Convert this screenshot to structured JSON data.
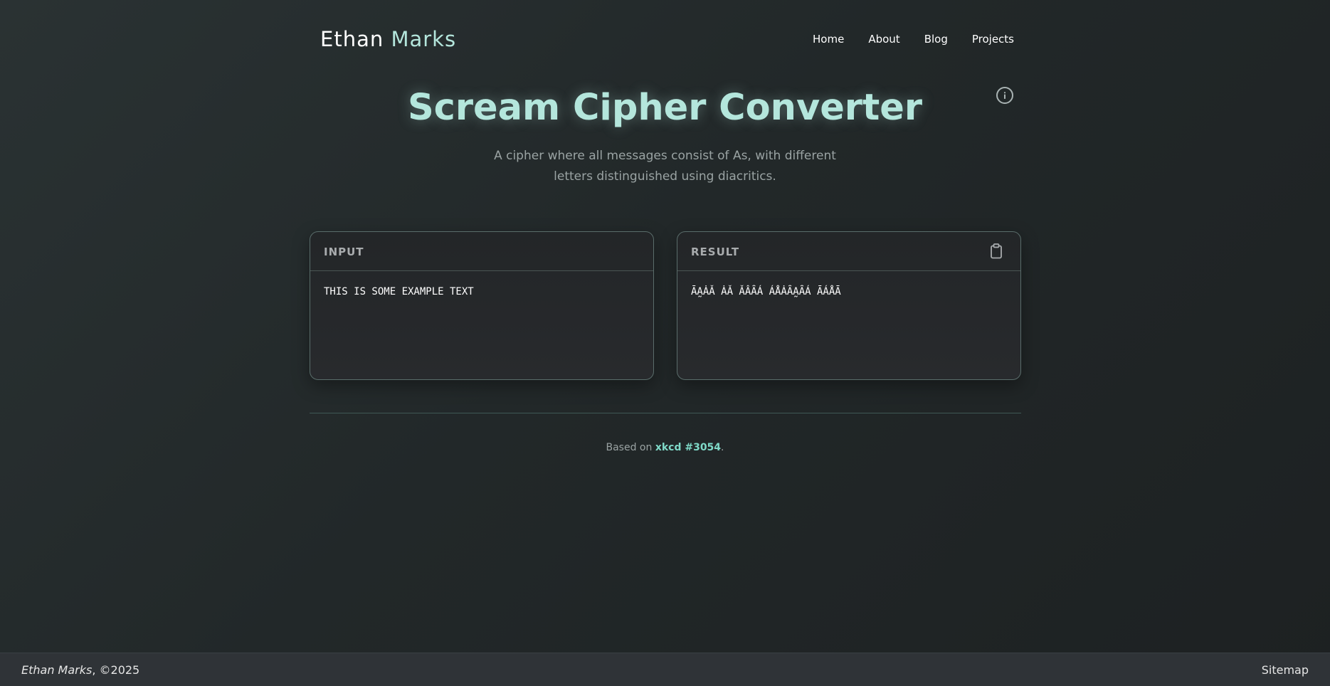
{
  "header": {
    "brand_first": "Ethan ",
    "brand_second": "Marks",
    "nav": [
      {
        "label": "Home"
      },
      {
        "label": "About"
      },
      {
        "label": "Blog"
      },
      {
        "label": "Projects"
      }
    ]
  },
  "main": {
    "title": "Scream Cipher Converter",
    "subtitle": "A cipher where all messages consist of As, with different letters distinguished using diacritics."
  },
  "input_panel": {
    "label": "INPUT",
    "value": "THIS IS SOME EXAMPLE TEXT"
  },
  "result_panel": {
    "label": "RESULT",
    "value": "ĀA̰ȦǍ ȦǍ ǍÂȂÁ ÁÅȦȂA̰ȂÁ ĀÁÅĀ"
  },
  "credit": {
    "prefix": "Based on ",
    "link": "xkcd #3054",
    "suffix": "."
  },
  "footer": {
    "name": "Ethan Marks",
    "copyright": ", ©2025",
    "sitemap": "Sitemap"
  },
  "colors": {
    "accent": "#b4e6dc",
    "link": "#7fd9c8",
    "background": "#222829"
  },
  "icons": {
    "info": "info-icon",
    "copy": "clipboard-icon"
  }
}
